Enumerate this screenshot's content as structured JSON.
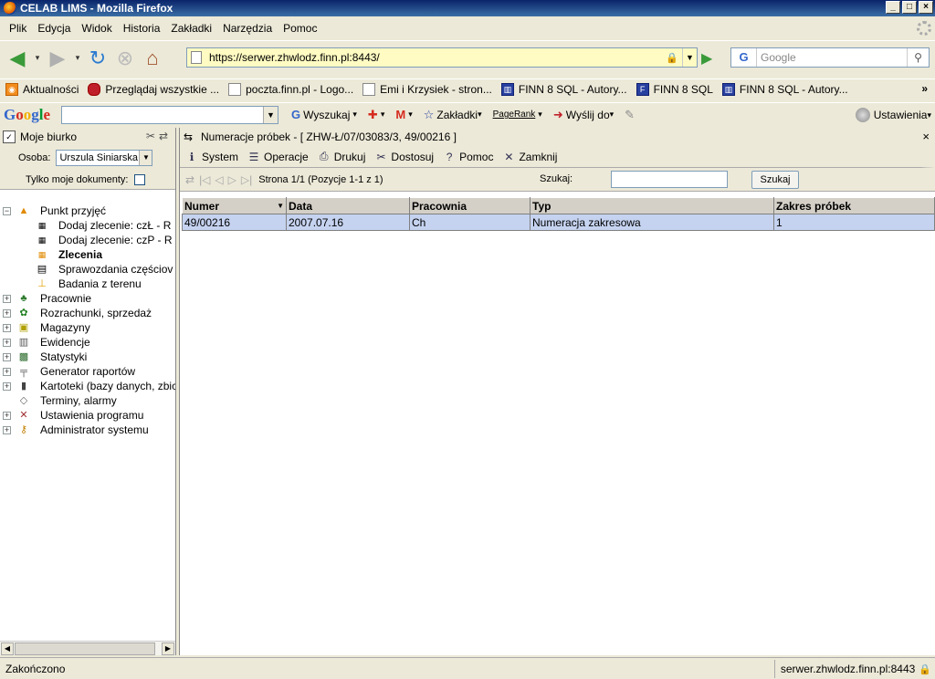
{
  "window": {
    "title": "CELAB LIMS - Mozilla Firefox"
  },
  "menubar": [
    "Plik",
    "Edycja",
    "Widok",
    "Historia",
    "Zakładki",
    "Narzędzia",
    "Pomoc"
  ],
  "navbar": {
    "url": "https://serwer.zhwlodz.finn.pl:8443/",
    "search_placeholder": "Google",
    "search_engine": "G"
  },
  "bookmarks": [
    "Aktualności",
    "Przeglądaj wszystkie ...",
    "poczta.finn.pl - Logo...",
    "Emi i Krzysiek - stron...",
    "FINN 8 SQL - Autory...",
    "FINN 8 SQL",
    "FINN 8 SQL - Autory..."
  ],
  "google_toolbar": {
    "logo": "Google",
    "search": "Wyszukaj",
    "bookmarks": "Zakładki",
    "pagerank": "PageRank",
    "send_to": "Wyślij do",
    "settings": "Ustawienia"
  },
  "left": {
    "title": "Moje biurko",
    "osoba_label": "Osoba:",
    "osoba_value": "Urszula Siniarska",
    "only_mine_label": "Tylko moje dokumenty:",
    "tree": {
      "punkt": "Punkt przyjęć",
      "dodaj_czl": "Dodaj zlecenie: czŁ - R",
      "dodaj_czp": "Dodaj zlecenie: czP - R",
      "zlecenia": "Zlecenia",
      "sprawozdania": "Sprawozdania częściov",
      "badania": "Badania z terenu",
      "pracownie": "Pracownie",
      "rozrachunki": "Rozrachunki, sprzedaż",
      "magazyny": "Magazyny",
      "ewidencje": "Ewidencje",
      "statystyki": "Statystyki",
      "generator": "Generator raportów",
      "kartoteki": "Kartoteki (bazy danych, zbic",
      "terminy": "Terminy, alarmy",
      "ustawienia": "Ustawienia programu",
      "admin": "Administrator systemu"
    }
  },
  "right": {
    "title": "Numeracje próbek - [ ZHW-Ł/07/03083/3, 49/00216 ]",
    "menu": [
      "System",
      "Operacje",
      "Drukuj",
      "Dostosuj",
      "Pomoc",
      "Zamknij"
    ],
    "pager_text": "Strona 1/1 (Pozycje 1-1 z 1)",
    "search_label": "Szukaj:",
    "search_button": "Szukaj",
    "columns": [
      "Numer",
      "Data",
      "Pracownia",
      "Typ",
      "Zakres próbek"
    ],
    "rows": [
      [
        "49/00216",
        "2007.07.16",
        "Ch",
        "Numeracja zakresowa",
        "1"
      ]
    ]
  },
  "status": {
    "left": "Zakończono",
    "right": "serwer.zhwlodz.finn.pl:8443"
  }
}
